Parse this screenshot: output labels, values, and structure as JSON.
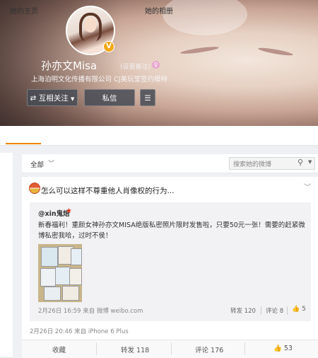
{
  "profile": {
    "name": "孙亦文Misa",
    "remark": "(设置备注)",
    "verified_text": "上海泊明文化传播有限公司 CJ美玩堂签约模特",
    "v_badge": "V",
    "gender_icon": "female-icon",
    "follow_button": "互相关注",
    "message_button": "私信",
    "more_icon": "menu-icon"
  },
  "tabs": {
    "home": "她的主页",
    "album": "她的相册"
  },
  "filter": {
    "all_label": "全部",
    "search_placeholder": "搜索她的微博"
  },
  "post": {
    "text": "怎么可以这样不尊重他人肖像权的行为...",
    "meta": "2月26日 20:46 来自 iPhone 6 Plus",
    "repost": {
      "user": "@xin鬼焙",
      "text": "新春福利！重颜女神孙亦文MISA绝版私密照片限时发售啦，只要50元一张！需要的赶紧微博私密我哈，过时不侯！",
      "meta": "2月26日 16:59 来自 微博 weibo.com",
      "repost_label": "转发 120",
      "comment_label": "评论 8",
      "like_count": "5"
    },
    "actions": {
      "collect": "收藏",
      "repost": "转发 118",
      "comment": "评论 176",
      "like": "53"
    }
  },
  "colors": {
    "accent": "#f08300",
    "link": "#eb7350"
  }
}
